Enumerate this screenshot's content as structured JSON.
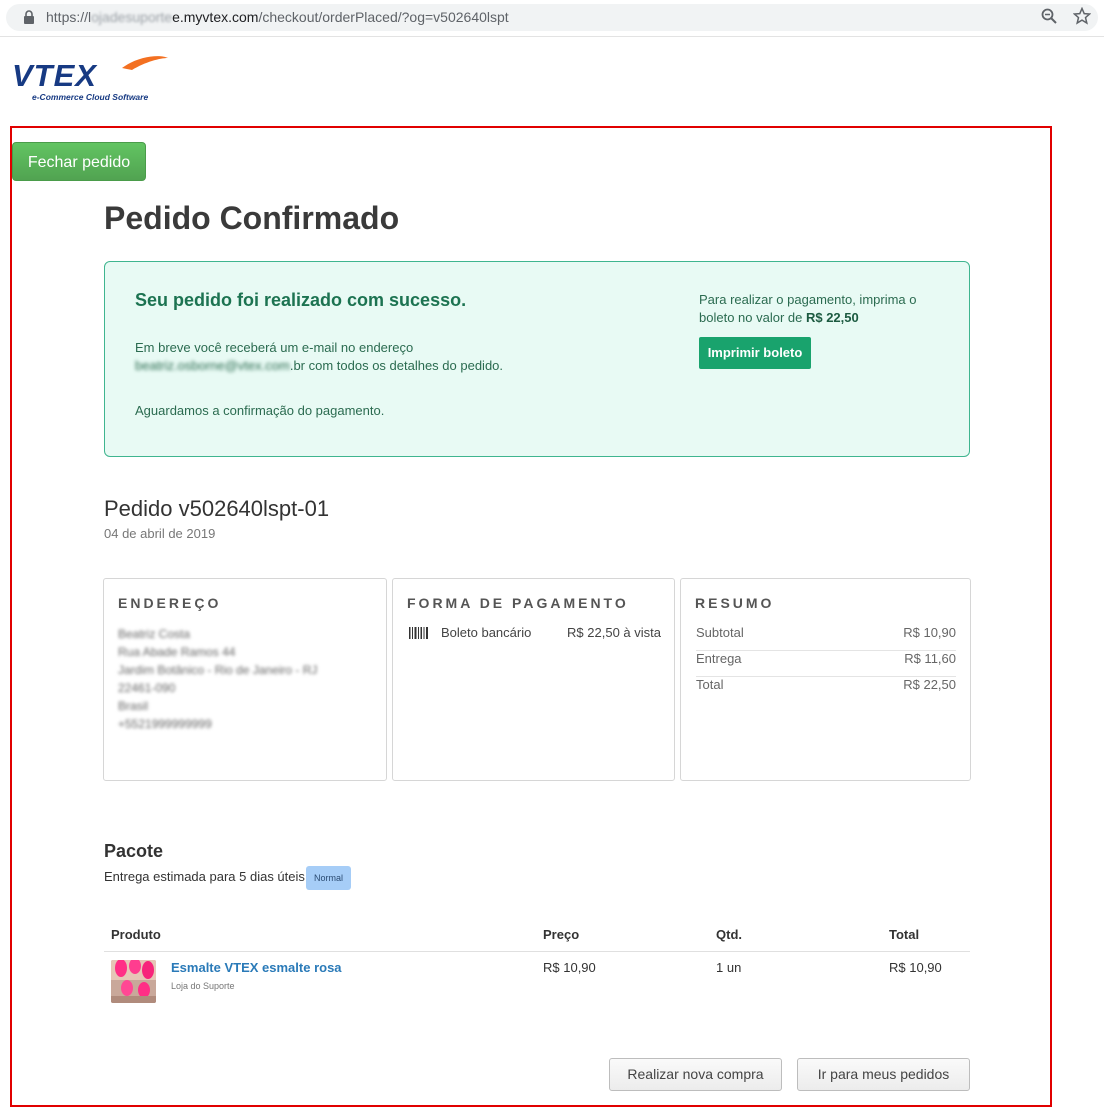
{
  "browser": {
    "url_prefix": "https://l",
    "url_blurred": "ojadesuporte",
    "url_domain": "e.myvtex.com",
    "url_path": "/checkout/orderPlaced/?og=v502640lspt"
  },
  "logo": {
    "brand": "VTEX",
    "tagline": "e-Commerce Cloud Software"
  },
  "close_button": "Fechar pedido",
  "page_title": "Pedido Confirmado",
  "success": {
    "heading": "Seu pedido foi realizado com sucesso.",
    "email_before": "Em breve você receberá um e-mail no endereço ",
    "email_blurred": "beatriz.osborne@vtex.com",
    "email_after": ".br com todos os detalhes do pedido.",
    "awaiting": "Aguardamos a confirmação do pagamento.",
    "pay_text": "Para realizar o pagamento, imprima o boleto no valor de ",
    "pay_amount": "R$ 22,50",
    "print_button": "Imprimir boleto"
  },
  "order": {
    "id": "Pedido v502640lspt-01",
    "date": "04 de abril de 2019"
  },
  "address": {
    "title": "ENDEREÇO",
    "lines": [
      "Beatriz Costa",
      "Rua Abade Ramos 44",
      "Jardim Botânico - Rio de Janeiro - RJ",
      "22461-090",
      "Brasil",
      "+5521999999999"
    ]
  },
  "payment": {
    "title": "FORMA DE PAGAMENTO",
    "method": "Boleto bancário",
    "amount": "R$ 22,50 à vista"
  },
  "summary": {
    "title": "RESUMO",
    "rows": [
      {
        "label": "Subtotal",
        "value": "R$ 10,90"
      },
      {
        "label": "Entrega",
        "value": "R$ 11,60"
      },
      {
        "label": "Total",
        "value": "R$ 22,50"
      }
    ]
  },
  "package": {
    "title": "Pacote",
    "estimate": "Entrega estimada para 5 dias úteis",
    "badge": "Normal"
  },
  "table": {
    "headers": {
      "product": "Produto",
      "price": "Preço",
      "qty": "Qtd.",
      "total": "Total"
    },
    "rows": [
      {
        "name": "Esmalte VTEX esmalte rosa",
        "seller": "Loja do Suporte",
        "price": "R$ 10,90",
        "qty": "1 un",
        "total": "R$ 10,90"
      }
    ]
  },
  "actions": {
    "new_purchase": "Realizar nova compra",
    "my_orders": "Ir para meus pedidos"
  },
  "colors": {
    "highlight_frame": "#e10000",
    "success_bg": "#e8faf4",
    "success_border": "#3fb58f",
    "primary_green": "#19a36d",
    "close_green": "#5cb85c",
    "link_blue": "#2a7ab8"
  }
}
